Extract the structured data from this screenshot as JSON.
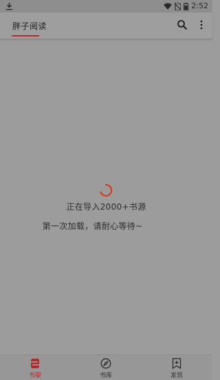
{
  "status_bar": {
    "time": "2:52",
    "icons": [
      "download-icon",
      "wifi-icon",
      "sim-off-icon",
      "battery-icon"
    ]
  },
  "app_bar": {
    "title": "胖子阅读",
    "icons": [
      "search-icon",
      "more-vert-icon"
    ]
  },
  "loading": {
    "line1": "正在导入2000+书源",
    "line2": "第一次加载，请耐心等待~"
  },
  "bottom_nav": {
    "items": [
      {
        "label": "书架",
        "icon": "bookshelf-icon",
        "active": true
      },
      {
        "label": "书库",
        "icon": "compass-icon",
        "active": false
      },
      {
        "label": "发现",
        "icon": "discover-bookmark-icon",
        "active": false
      }
    ]
  },
  "colors": {
    "accent": "#b22a2a",
    "overlay_background": "#9c9c9c"
  }
}
